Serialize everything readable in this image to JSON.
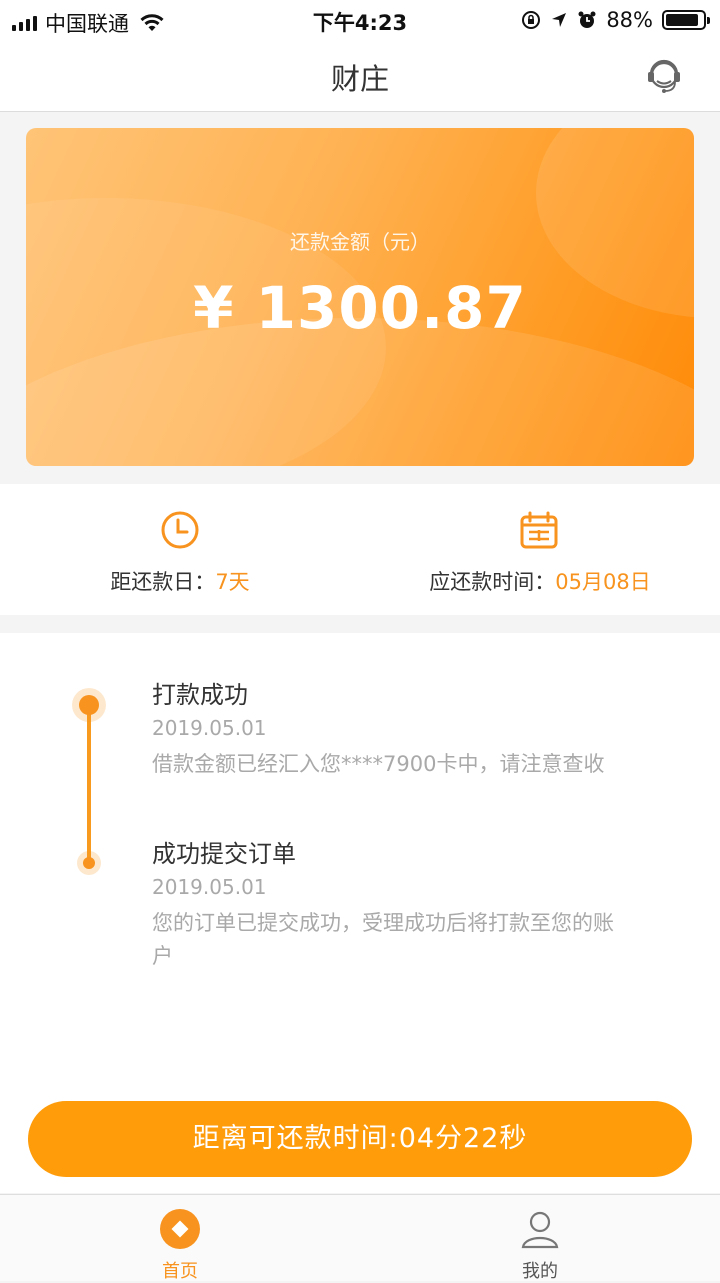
{
  "status_bar": {
    "carrier": "中国联通",
    "time": "下午4:23",
    "battery": "88%",
    "battery_level": 0.88
  },
  "nav": {
    "title": "财庄",
    "service_icon": "headset-service-icon"
  },
  "card": {
    "label": "还款金额（元）",
    "amount": "¥ 1300.87"
  },
  "info": {
    "days_left_label": "距还款日：",
    "days_left_value": "7天",
    "due_label": "应还款时间：",
    "due_value": "05月08日",
    "clock_icon": "clock-icon",
    "calendar_icon": "calendar-icon",
    "accent_color": "#f7931e"
  },
  "timeline": [
    {
      "title": "打款成功",
      "date": "2019.05.01",
      "desc": "借款金额已经汇入您****7900卡中，请注意查收"
    },
    {
      "title": "成功提交订单",
      "date": "2019.05.01",
      "desc": "您的订单已提交成功，受理成功后将打款至您的账户"
    }
  ],
  "countdown_button": "距离可还款时间:04分22秒",
  "tabs": [
    {
      "label": "首页",
      "icon": "home-icon",
      "active": true
    },
    {
      "label": "我的",
      "icon": "user-icon",
      "active": false
    }
  ]
}
